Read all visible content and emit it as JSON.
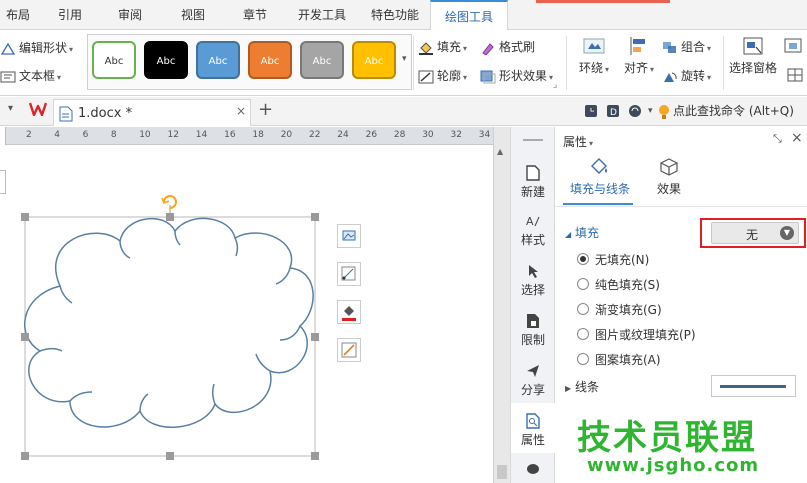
{
  "menu": {
    "tabs": [
      "布局",
      "引用",
      "审阅",
      "视图",
      "章节",
      "开发工具",
      "特色功能",
      "绘图工具"
    ],
    "active": "绘图工具"
  },
  "ribbon": {
    "edit_shape": "编辑形状",
    "textbox": "文本框",
    "styles": [
      {
        "label": "Abc",
        "bg": "#ffffff",
        "fg": "#333333",
        "border": "#6ab04c"
      },
      {
        "label": "Abc",
        "bg": "#000000",
        "fg": "#ffffff",
        "border": "#000000"
      },
      {
        "label": "Abc",
        "bg": "#5b9bd5",
        "fg": "#ffffff",
        "border": "#41719c"
      },
      {
        "label": "Abc",
        "bg": "#ed7d31",
        "fg": "#ffffff",
        "border": "#ae5a21"
      },
      {
        "label": "Abc",
        "bg": "#a5a5a5",
        "fg": "#ffffff",
        "border": "#787878"
      },
      {
        "label": "Abc",
        "bg": "#ffc000",
        "fg": "#ffffff",
        "border": "#bc8c00"
      }
    ],
    "fill": "填充",
    "format_brush": "格式刷",
    "outline": "轮廓",
    "shape_effects": "形状效果",
    "wrap": "环绕",
    "align": "对齐",
    "group": "组合",
    "rotate": "旋转",
    "selection_pane": "选择窗格"
  },
  "doc_tabs": {
    "file_name": "1.docx *",
    "find_command": "点此查找命令 (Alt+Q)"
  },
  "ruler": {
    "ticks": [
      "2",
      "4",
      "6",
      "8",
      "10",
      "12",
      "14",
      "16",
      "18",
      "20",
      "22",
      "24",
      "26",
      "28",
      "30",
      "32",
      "34"
    ]
  },
  "side_toolbar": {
    "items": [
      "新建",
      "样式",
      "选择",
      "限制",
      "分享",
      "属性"
    ]
  },
  "panel": {
    "title": "属性",
    "tab_fill": "填充与线条",
    "tab_effect": "效果",
    "fill_section": "填充",
    "fill_value": "无",
    "options": [
      "无填充(N)",
      "纯色填充(S)",
      "渐变填充(G)",
      "图片或纹理填充(P)",
      "图案填充(A)"
    ],
    "selected_option": 0,
    "line_section": "线条",
    "highlight_color": "#e02020"
  },
  "watermark": {
    "title": "技术员联盟",
    "url": "www.jsgho.com"
  },
  "colors": {
    "accent": "#3a8ddc",
    "shape_stroke": "#5a7fa3",
    "watermark_green": "#2fb52f"
  }
}
